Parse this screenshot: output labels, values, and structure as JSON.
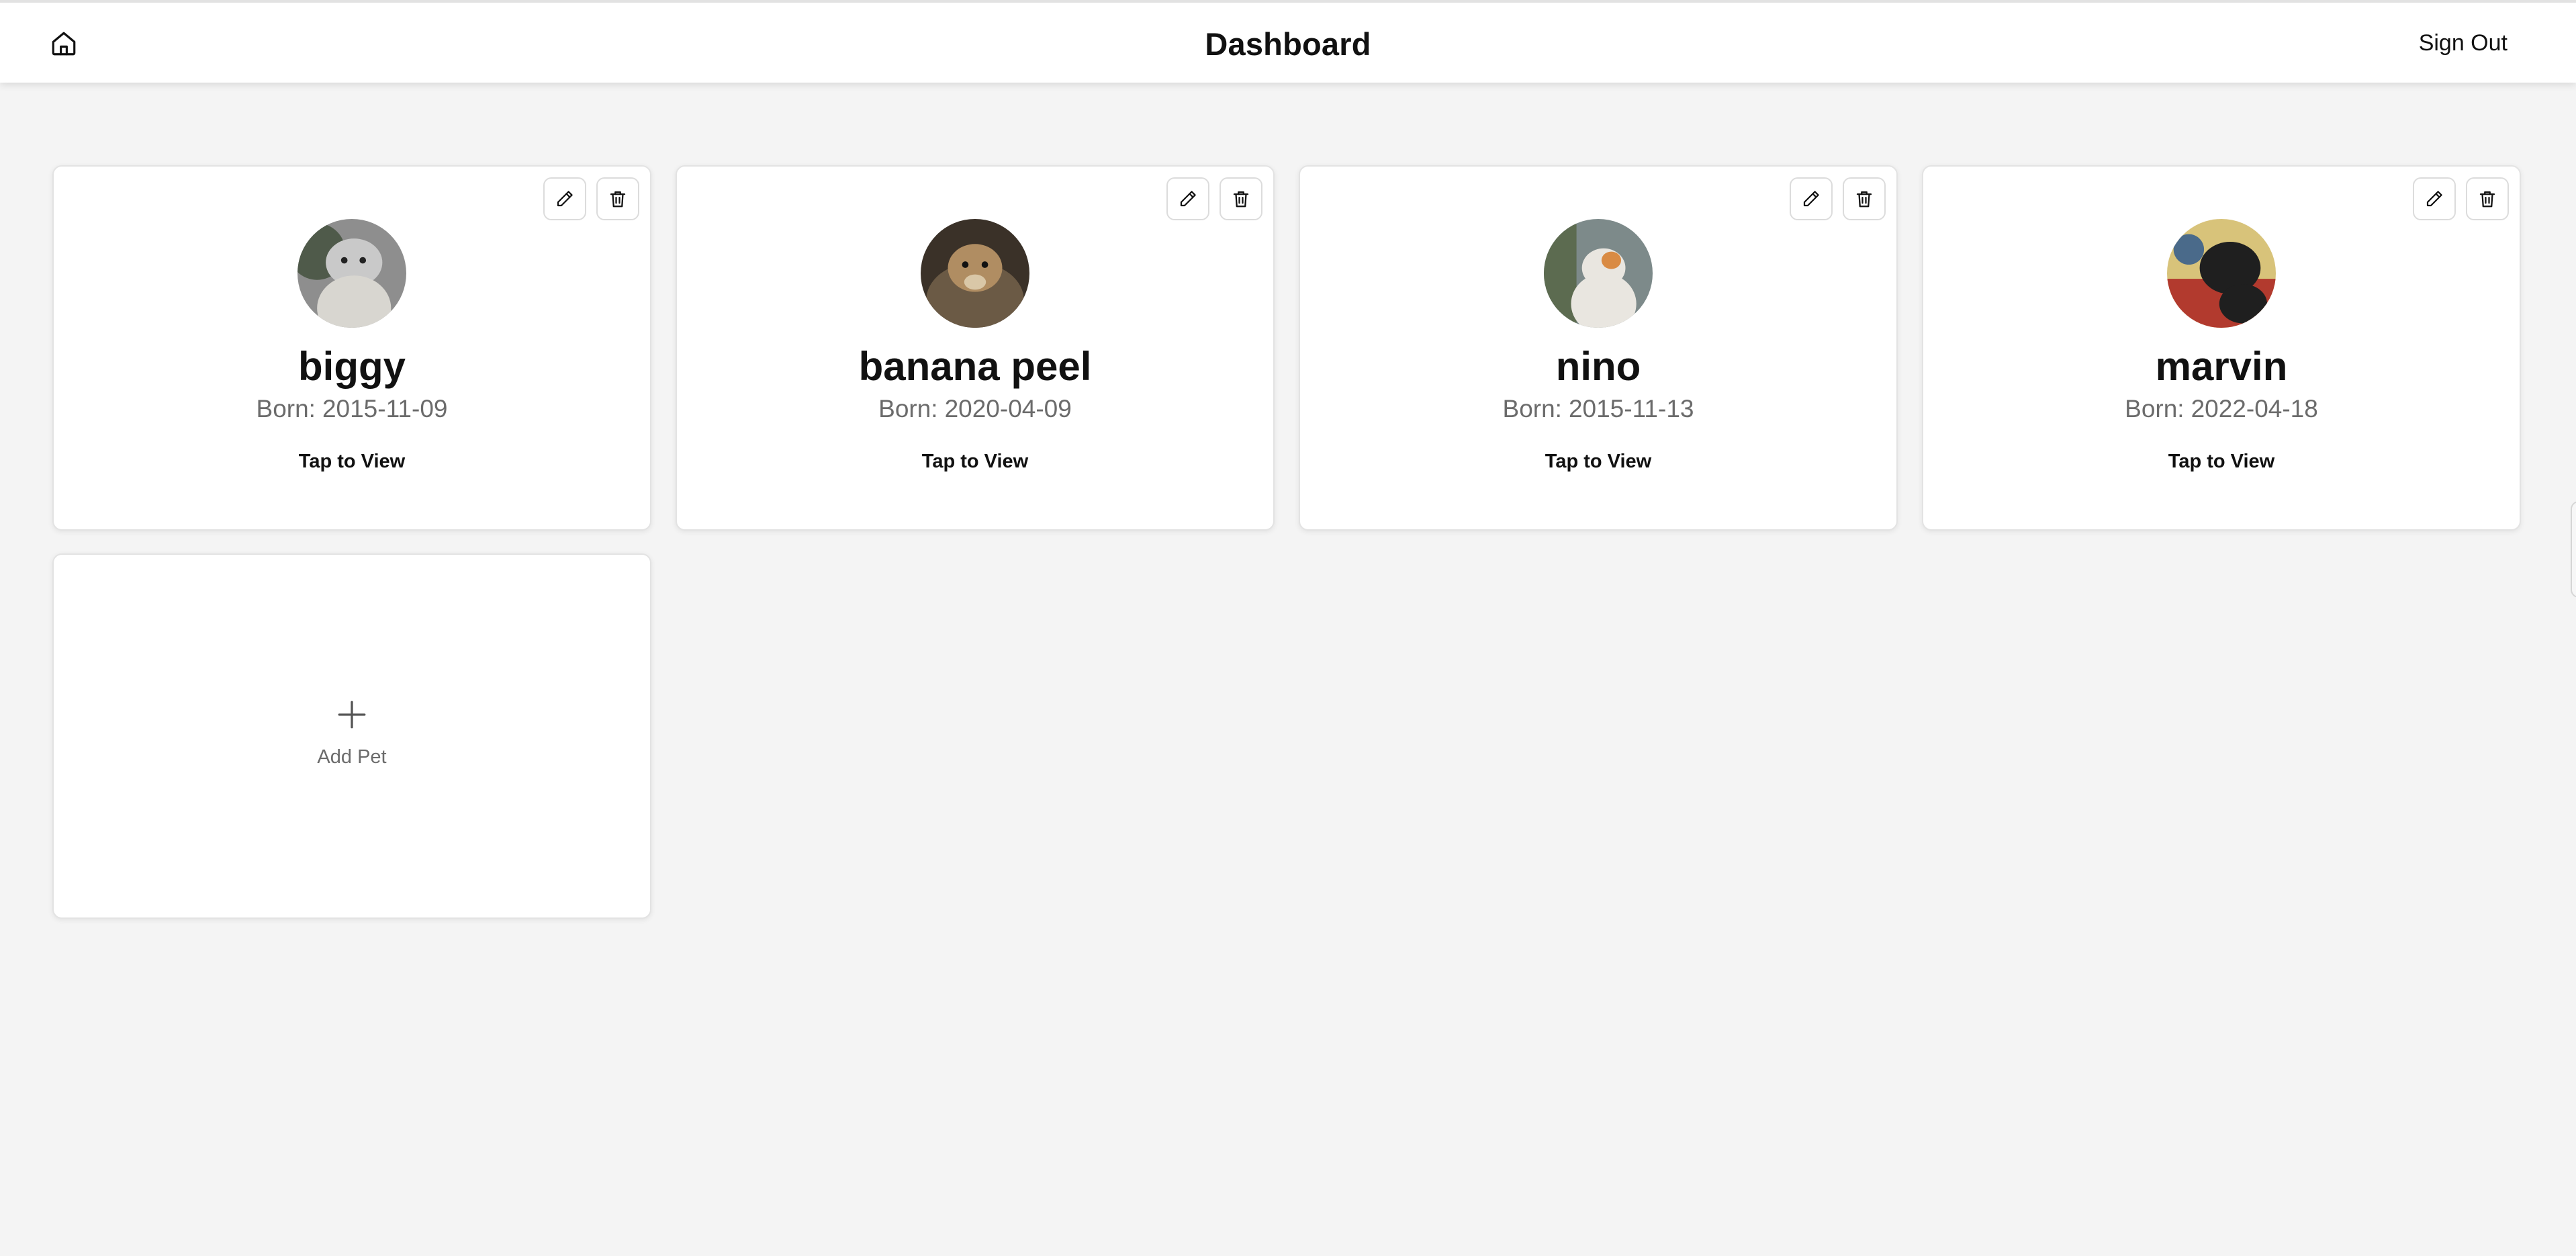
{
  "header": {
    "title": "Dashboard",
    "home_icon": "home-icon",
    "sign_out_label": "Sign Out"
  },
  "pets": [
    {
      "name": "biggy",
      "born_label": "Born:",
      "born": "2015-11-09",
      "tap_label": "Tap to View",
      "photo_colors": [
        "#8e8e8e",
        "#c9c9c9",
        "#4f5a4a",
        "#d8d6d0"
      ]
    },
    {
      "name": "banana peel",
      "born_label": "Born:",
      "born": "2020-04-09",
      "tap_label": "Tap to View",
      "photo_colors": [
        "#6b5a45",
        "#b08d62",
        "#3a3128",
        "#d9c7a7"
      ]
    },
    {
      "name": "nino",
      "born_label": "Born:",
      "born": "2015-11-13",
      "tap_label": "Tap to View",
      "photo_colors": [
        "#5c6b50",
        "#e9e6e0",
        "#d98b44",
        "#7d8a8a"
      ]
    },
    {
      "name": "marvin",
      "born_label": "Born:",
      "born": "2022-04-18",
      "tap_label": "Tap to View",
      "photo_colors": [
        "#b23a2e",
        "#1f1f1f",
        "#d8c37a",
        "#4a6a8a"
      ]
    }
  ],
  "add_pet": {
    "label": "Add Pet",
    "icon": "plus-icon"
  },
  "action_icons": {
    "edit": "pencil-icon",
    "delete": "trash-icon"
  },
  "colors": {
    "background": "#f4f4f4",
    "card": "#ffffff",
    "border": "#e3e3e3",
    "muted_text": "#6b6b6b",
    "text": "#111111"
  }
}
